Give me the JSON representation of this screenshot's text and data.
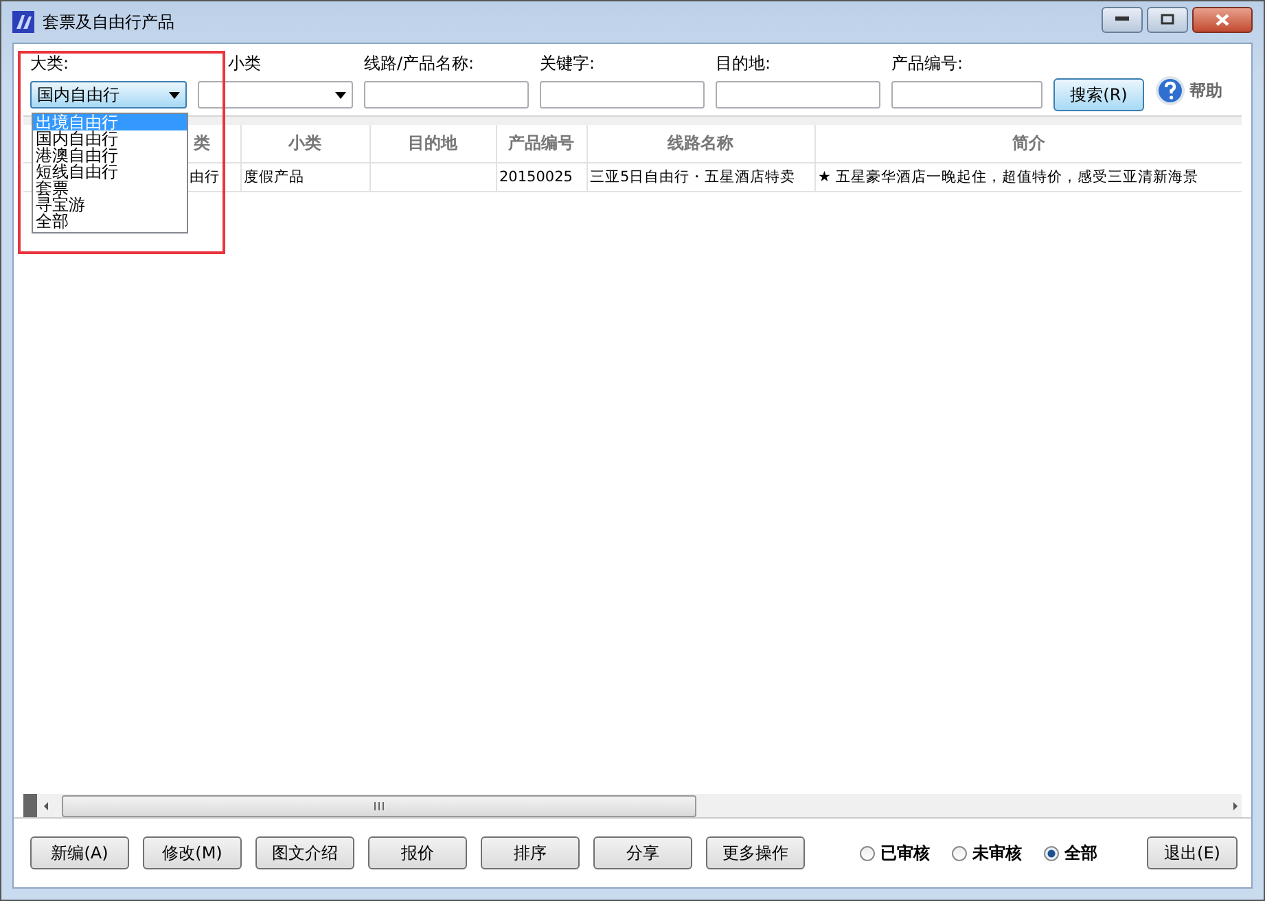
{
  "window": {
    "title": "套票及自由行产品"
  },
  "filters": [
    {
      "label": "大类:",
      "kind": "select",
      "value": "国内自由行",
      "open": true
    },
    {
      "label": "小类",
      "kind": "select",
      "open": false
    },
    {
      "label": "线路/产品名称:",
      "kind": "text"
    },
    {
      "label": "关键字:",
      "kind": "text"
    },
    {
      "label": "目的地:",
      "kind": "text"
    },
    {
      "label": "产品编号:",
      "kind": "text"
    }
  ],
  "dropdown": {
    "options": [
      {
        "label": "出境自由行",
        "selected": true
      },
      {
        "label": "国内自由行",
        "selected": false
      },
      {
        "label": "港澳自由行",
        "selected": false
      },
      {
        "label": "短线自由行",
        "selected": false
      },
      {
        "label": "套票",
        "selected": false
      },
      {
        "label": "寻宝游",
        "selected": false
      },
      {
        "label": "全部",
        "selected": false
      }
    ]
  },
  "search_button": "搜索(R)",
  "help": "帮助",
  "table": {
    "columns": [
      "类",
      "小类",
      "目的地",
      "产品编号",
      "线路名称",
      "简介"
    ],
    "rows": [
      [
        "由行",
        "度假产品",
        "",
        "20150025",
        "三亚5日自由行・五星酒店特卖",
        "★ 五星豪华酒店一晚起住，超值特价，感受三亚清新海景"
      ]
    ]
  },
  "buttons": [
    "新编(A)",
    "修改(M)",
    "图文介绍",
    "报价",
    "排序",
    "分享",
    "更多操作"
  ],
  "audit_filter": [
    {
      "label": "已审核",
      "selected": false
    },
    {
      "label": "未审核",
      "selected": false
    },
    {
      "label": "全部",
      "selected": true
    }
  ],
  "exit_button": "退出(E)"
}
